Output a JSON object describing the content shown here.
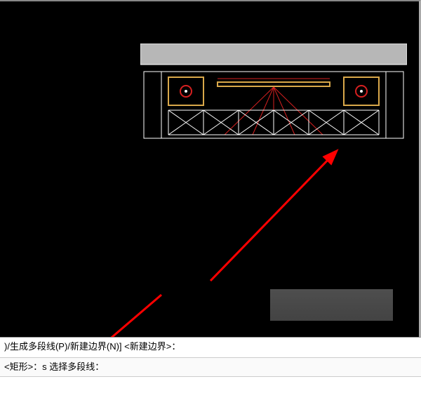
{
  "command_panel": {
    "line1": ")/生成多段线(P)/新建边界(N)] <新建边界>：",
    "line2": "<矩形>：s 选择多段线："
  },
  "drawing": {
    "description": "architectural-section-elevation",
    "colors": {
      "outline": "#ffffff",
      "accent_yellow": "#d9a84a",
      "accent_red": "#d62020",
      "gray_band": "#b7b7b7"
    }
  },
  "annotations": {
    "arrow_color": "#ff0000",
    "arrow1_target": "drawing",
    "arrow2_target": "command-line"
  }
}
